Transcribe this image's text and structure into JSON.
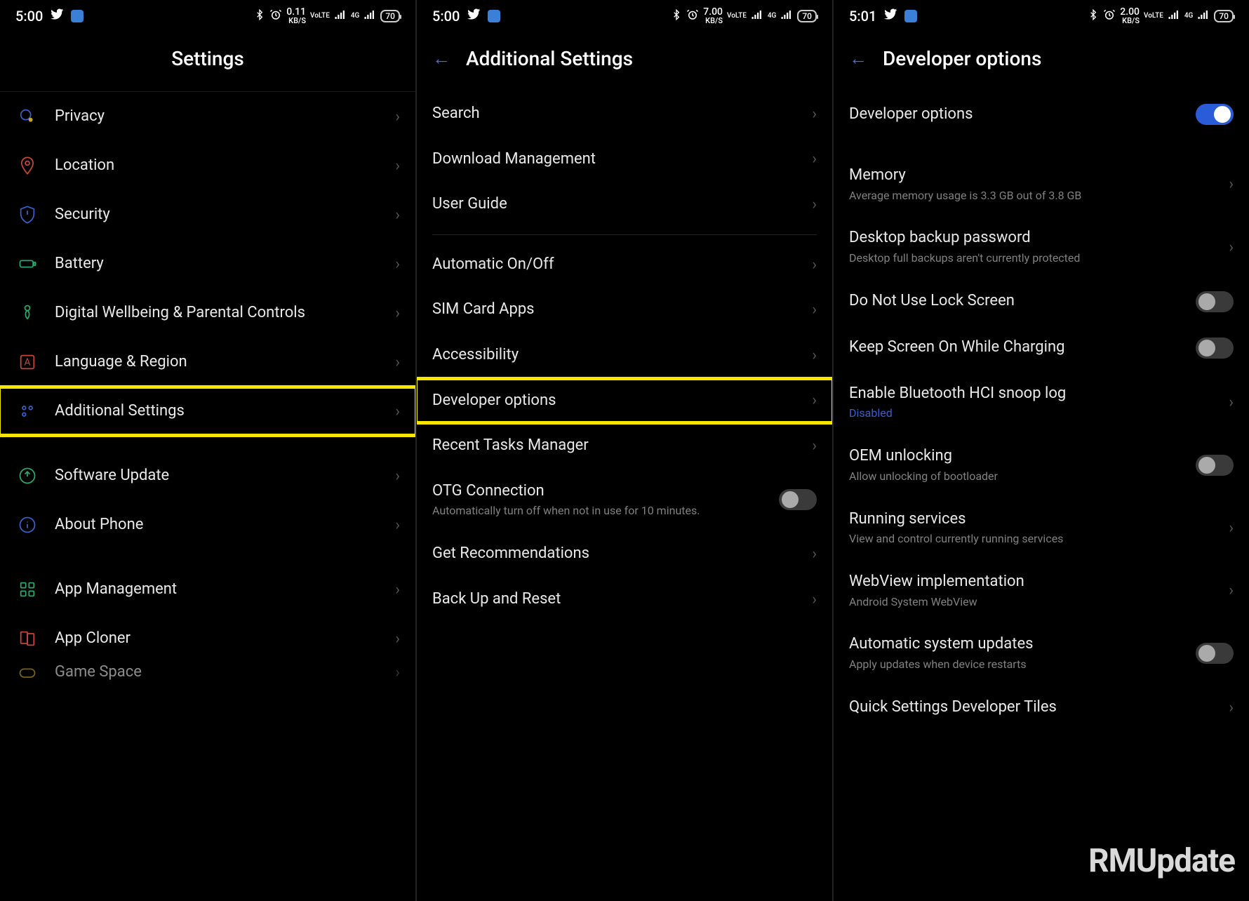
{
  "phones": [
    {
      "status": {
        "time": "5:00",
        "kbps": "0.11",
        "battery": "70"
      },
      "title": "Settings",
      "hasBack": false,
      "items": [
        {
          "icon": "privacy",
          "label": "Privacy",
          "chev": true
        },
        {
          "icon": "location",
          "label": "Location",
          "chev": true
        },
        {
          "icon": "security",
          "label": "Security",
          "chev": true
        },
        {
          "icon": "battery",
          "label": "Battery",
          "chev": true
        },
        {
          "icon": "wellbeing",
          "label": "Digital Wellbeing & Parental Controls",
          "chev": true
        },
        {
          "icon": "language",
          "label": "Language & Region",
          "chev": true
        },
        {
          "icon": "additional",
          "label": "Additional Settings",
          "chev": true,
          "highlight": true
        },
        {
          "gap": true
        },
        {
          "icon": "update",
          "label": "Software Update",
          "chev": true
        },
        {
          "icon": "about",
          "label": "About Phone",
          "chev": true
        },
        {
          "gap": true
        },
        {
          "icon": "apps",
          "label": "App Management",
          "chev": true
        },
        {
          "icon": "cloner",
          "label": "App Cloner",
          "chev": true
        },
        {
          "icon": "game",
          "label": "Game Space",
          "chev": true,
          "cut": true
        }
      ]
    },
    {
      "status": {
        "time": "5:00",
        "kbps": "7.00",
        "battery": "70"
      },
      "title": "Additional Settings",
      "hasBack": true,
      "items": [
        {
          "label": "Search",
          "chev": true
        },
        {
          "label": "Download Management",
          "chev": true
        },
        {
          "label": "User Guide",
          "chev": true
        },
        {
          "sep": true
        },
        {
          "label": "Automatic On/Off",
          "chev": true
        },
        {
          "label": "SIM Card Apps",
          "chev": true
        },
        {
          "label": "Accessibility",
          "chev": true
        },
        {
          "label": "Developer options",
          "chev": true,
          "highlight": true
        },
        {
          "label": "Recent Tasks Manager",
          "chev": true
        },
        {
          "label": "OTG Connection",
          "sub": "Automatically turn off when not in use for 10 minutes.",
          "toggle": "off"
        },
        {
          "label": "Get Recommendations",
          "chev": true
        },
        {
          "label": "Back Up and Reset",
          "chev": true
        }
      ]
    },
    {
      "status": {
        "time": "5:01",
        "kbps": "2.00",
        "battery": "70"
      },
      "title": "Developer options",
      "hasBack": true,
      "items": [
        {
          "label": "Developer options",
          "toggle": "on"
        },
        {
          "gap": true
        },
        {
          "label": "Memory",
          "sub": "Average memory usage is 3.3 GB out of 3.8 GB",
          "chev": true
        },
        {
          "label": "Desktop backup password",
          "sub": "Desktop full backups aren't currently protected",
          "chev": true
        },
        {
          "label": "Do Not Use Lock Screen",
          "toggle": "off"
        },
        {
          "label": "Keep Screen On While Charging",
          "toggle": "off"
        },
        {
          "label": "Enable Bluetooth HCI snoop log",
          "sub": "Disabled",
          "subAccent": true,
          "chev": true
        },
        {
          "label": "OEM unlocking",
          "sub": "Allow unlocking of bootloader",
          "toggle": "off"
        },
        {
          "label": "Running services",
          "sub": "View and control currently running services",
          "chev": true
        },
        {
          "label": "WebView implementation",
          "sub": "Android System WebView",
          "chev": true
        },
        {
          "label": "Automatic system updates",
          "sub": "Apply updates when device restarts",
          "toggle": "off"
        },
        {
          "label": "Quick Settings Developer Tiles",
          "chev": true
        }
      ],
      "watermark": "RMUpdate"
    }
  ],
  "status_labels": {
    "kbps_unit": "KB/S",
    "volte": "VoLTE",
    "net": "4G"
  }
}
